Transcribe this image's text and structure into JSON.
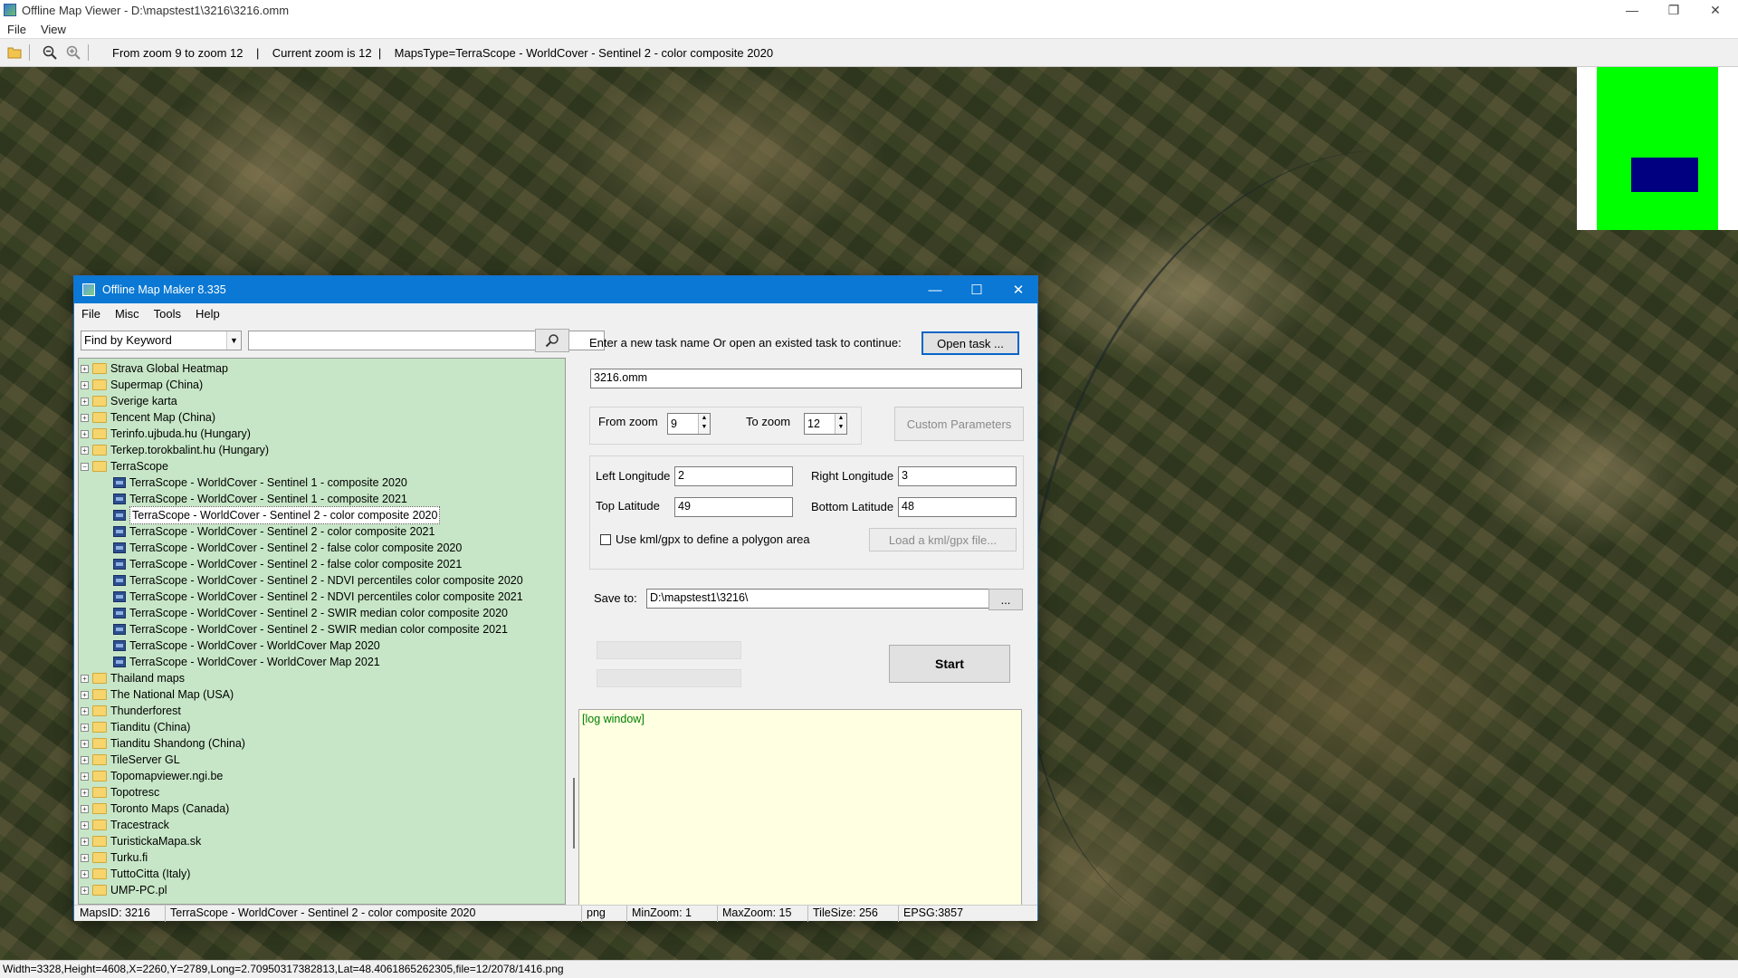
{
  "window": {
    "title": "Offline Map Viewer - D:\\mapstest1\\3216\\3216.omm",
    "minimize": "—",
    "maximize": "❐",
    "close": "✕"
  },
  "menu": [
    "File",
    "View"
  ],
  "toolbar": {
    "open_icon": "folder-open-icon",
    "zoom_out_icon": "zoom-out-icon",
    "zoom_in_icon": "zoom-in-icon",
    "info": "From zoom 9 to zoom 12    |    Current zoom is 12  |    MapsType=TerraScope - WorldCover - Sentinel 2 - color composite 2020"
  },
  "minimap": {
    "outer_color": "#ffffff",
    "area_color": "#00ff00",
    "view_color": "#000080"
  },
  "status": "Width=3328,Height=4608,X=2260,Y=2789,Long=2.70950317382813,Lat=48.4061865262305,file=12/2078/1416.png",
  "dialog": {
    "title": "Offline Map Maker 8.335",
    "menu": [
      "File",
      "Misc",
      "Tools",
      "Help"
    ],
    "keyword_select": "Find by Keyword",
    "keyword_value": "",
    "tree": [
      {
        "label": "Strava Global Heatmap",
        "type": "folder",
        "exp": "+"
      },
      {
        "label": "Supermap (China)",
        "type": "folder",
        "exp": "+"
      },
      {
        "label": "Sverige karta",
        "type": "folder",
        "exp": "+"
      },
      {
        "label": "Tencent Map (China)",
        "type": "folder",
        "exp": "+"
      },
      {
        "label": "Terinfo.ujbuda.hu (Hungary)",
        "type": "folder",
        "exp": "+"
      },
      {
        "label": "Terkep.torokbalint.hu (Hungary)",
        "type": "folder",
        "exp": "+"
      },
      {
        "label": "TerraScope",
        "type": "folder-open",
        "exp": "−"
      },
      {
        "label": "TerraScope - WorldCover - Sentinel 1 - composite 2020",
        "type": "map"
      },
      {
        "label": "TerraScope - WorldCover - Sentinel 1 - composite 2021",
        "type": "map"
      },
      {
        "label": "TerraScope - WorldCover - Sentinel 2 - color composite 2020",
        "type": "map",
        "selected": true
      },
      {
        "label": "TerraScope - WorldCover - Sentinel 2 - color composite 2021",
        "type": "map"
      },
      {
        "label": "TerraScope - WorldCover - Sentinel 2 - false color composite 2020",
        "type": "map"
      },
      {
        "label": "TerraScope - WorldCover - Sentinel 2 - false color composite 2021",
        "type": "map"
      },
      {
        "label": "TerraScope - WorldCover - Sentinel 2 - NDVI percentiles color composite 2020",
        "type": "map"
      },
      {
        "label": "TerraScope - WorldCover - Sentinel 2 - NDVI percentiles color composite 2021",
        "type": "map"
      },
      {
        "label": "TerraScope - WorldCover - Sentinel 2 - SWIR median color composite 2020",
        "type": "map"
      },
      {
        "label": "TerraScope - WorldCover - Sentinel 2 - SWIR median color composite 2021",
        "type": "map"
      },
      {
        "label": "TerraScope - WorldCover - WorldCover Map 2020",
        "type": "map"
      },
      {
        "label": "TerraScope - WorldCover - WorldCover Map 2021",
        "type": "map"
      },
      {
        "label": "Thailand maps",
        "type": "folder",
        "exp": "+"
      },
      {
        "label": "The National Map (USA)",
        "type": "folder",
        "exp": "+"
      },
      {
        "label": "Thunderforest",
        "type": "folder",
        "exp": "+"
      },
      {
        "label": "Tianditu (China)",
        "type": "folder",
        "exp": "+"
      },
      {
        "label": "Tianditu Shandong (China)",
        "type": "folder",
        "exp": "+"
      },
      {
        "label": "TileServer GL",
        "type": "folder",
        "exp": "+"
      },
      {
        "label": "Topomapviewer.ngi.be",
        "type": "folder",
        "exp": "+"
      },
      {
        "label": "Topotresc",
        "type": "folder",
        "exp": "+"
      },
      {
        "label": "Toronto Maps (Canada)",
        "type": "folder",
        "exp": "+"
      },
      {
        "label": "Tracestrack",
        "type": "folder",
        "exp": "+"
      },
      {
        "label": "TuristickaMapa.sk",
        "type": "folder",
        "exp": "+"
      },
      {
        "label": "Turku.fi",
        "type": "folder",
        "exp": "+"
      },
      {
        "label": "TuttoCitta (Italy)",
        "type": "folder",
        "exp": "+"
      },
      {
        "label": "UMP-PC.pl",
        "type": "folder",
        "exp": "+"
      }
    ],
    "task_prompt": "Enter a new task name Or open an existed task to continue:",
    "open_task": "Open task ...",
    "task_name": "3216.omm",
    "from_zoom_label": "From zoom",
    "from_zoom": "9",
    "to_zoom_label": "To zoom",
    "to_zoom": "12",
    "custom_params": "Custom Parameters",
    "left_lon_label": "Left Longitude",
    "left_lon": "2",
    "right_lon_label": "Right Longitude",
    "right_lon": "3",
    "top_lat_label": "Top Latitude",
    "top_lat": "49",
    "bottom_lat_label": "Bottom Latitude",
    "bottom_lat": "48",
    "kml_check_label": "Use kml/gpx to define a polygon area",
    "load_kml": "Load a kml/gpx file...",
    "save_to_label": "Save to:",
    "save_to": "D:\\mapstest1\\3216\\",
    "browse": "...",
    "start": "Start",
    "log": "[log window]",
    "status": {
      "maps_id": "MapsID: 3216",
      "map_name": "TerraScope - WorldCover - Sentinel 2 - color composite 2020",
      "format": "png",
      "min_zoom": "MinZoom: 1",
      "max_zoom": "MaxZoom: 15",
      "tile_size": "TileSize: 256",
      "epsg": "EPSG:3857"
    }
  }
}
